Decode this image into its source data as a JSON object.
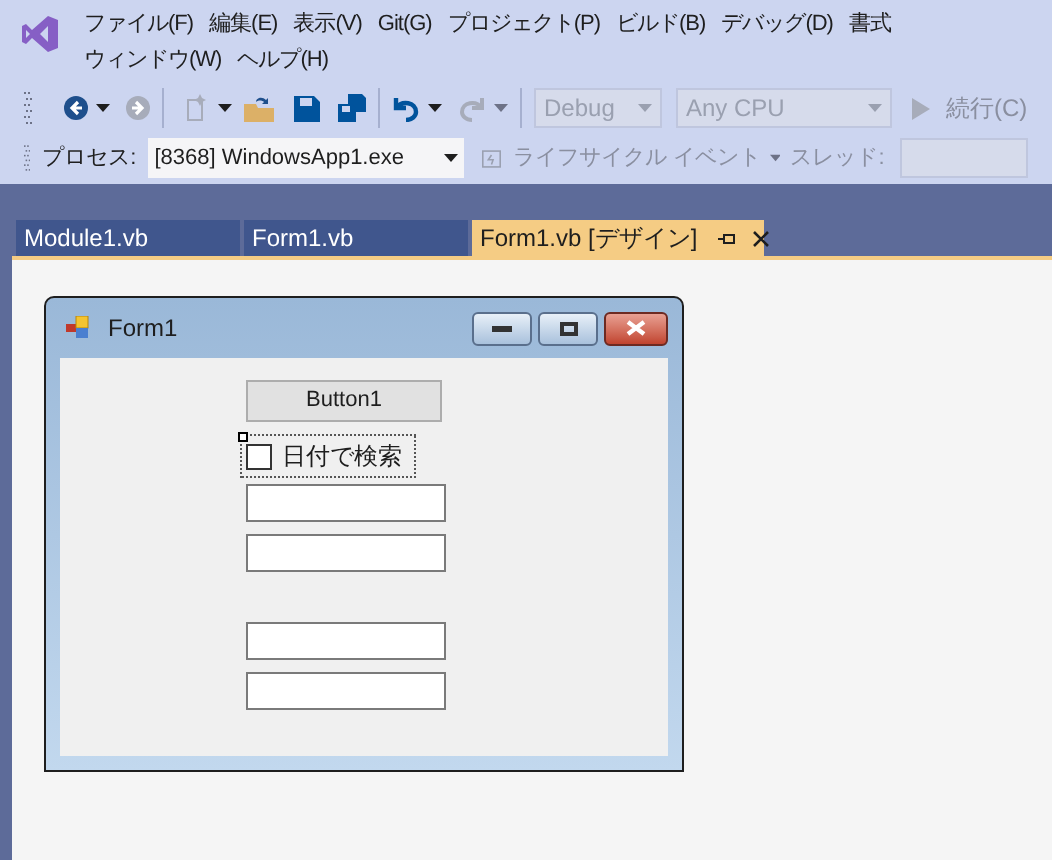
{
  "menu": [
    "ファイル(F)",
    "編集(E)",
    "表示(V)",
    "Git(G)",
    "プロジェクト(P)",
    "ビルド(B)",
    "デバッグ(D)",
    "書式",
    "ウィンドウ(W)",
    "ヘルプ(H)"
  ],
  "toolbar": {
    "configuration": {
      "value": "Debug",
      "disabled": true
    },
    "platform": {
      "value": "Any CPU",
      "disabled": true
    },
    "continue": "続行(C)"
  },
  "debug_location": {
    "process_label": "プロセス:",
    "process": "[8368] WindowsApp1.exe",
    "lifecycle": "ライフサイクル イベント",
    "thread_label": "スレッド:"
  },
  "tabs": [
    {
      "label": "Module1.vb",
      "selected": false
    },
    {
      "label": "Form1.vb",
      "selected": false
    },
    {
      "label": "Form1.vb [デザイン]",
      "selected": true
    }
  ],
  "form": {
    "title": "Form1",
    "button": "Button1",
    "checkbox": {
      "label": "日付で検索",
      "checked": false
    },
    "text_boxes": [
      {
        "kind": "text-box"
      },
      {
        "kind": "text-box"
      },
      {
        "kind": "text-box"
      },
      {
        "kind": "text-box"
      }
    ]
  }
}
